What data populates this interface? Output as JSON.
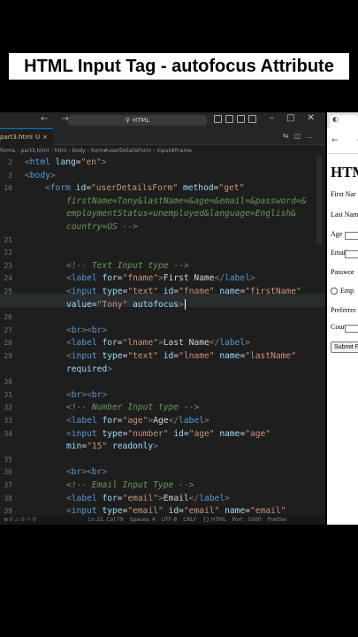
{
  "banner": {
    "title": "HTML Input Tag - autofocus Attribute"
  },
  "editor": {
    "search_label": "HTML",
    "tab_name": "part3.html",
    "tab_badge": "U",
    "left_tab_fragment": "forms",
    "breadcrumb": [
      "forms",
      "part3.html",
      "html",
      "body",
      "form#userDetailsForm",
      "input#fname"
    ],
    "lines": [
      {
        "n": "2",
        "indent": 1,
        "html": [
          [
            "tg",
            "<"
          ],
          [
            "tn",
            "html"
          ],
          [
            "an",
            " lang"
          ],
          [
            "tx",
            "="
          ],
          [
            "av",
            "\"en\""
          ],
          [
            "tg",
            ">"
          ]
        ]
      },
      {
        "n": "3",
        "indent": 1,
        "html": [
          [
            "tg",
            "<"
          ],
          [
            "tn",
            "body"
          ],
          [
            "tg",
            ">"
          ]
        ]
      },
      {
        "n": "10",
        "indent": 2,
        "html": [
          [
            "tg",
            "<"
          ],
          [
            "tn",
            "form"
          ],
          [
            "an",
            " id"
          ],
          [
            "tx",
            "="
          ],
          [
            "av",
            "\"userDetailsForm\""
          ],
          [
            "an",
            " method"
          ],
          [
            "tx",
            "="
          ],
          [
            "av",
            "\"get\""
          ]
        ]
      },
      {
        "n": "",
        "indent": 3,
        "html": [
          [
            "cm",
            "firstName=Tony&lastName=&age=&email=&password=&"
          ]
        ]
      },
      {
        "n": "",
        "indent": 3,
        "html": [
          [
            "cm",
            "employmentStatus=unemployed&language=English&"
          ]
        ]
      },
      {
        "n": "",
        "indent": 3,
        "html": [
          [
            "cm",
            "country=US -->"
          ]
        ]
      },
      {
        "n": "21",
        "indent": 3,
        "html": []
      },
      {
        "n": "22",
        "indent": 3,
        "html": []
      },
      {
        "n": "23",
        "indent": 3,
        "html": [
          [
            "cm",
            "<!-- Text Input type -->"
          ]
        ]
      },
      {
        "n": "24",
        "indent": 3,
        "html": [
          [
            "tg",
            "<"
          ],
          [
            "tn",
            "label"
          ],
          [
            "an",
            " for"
          ],
          [
            "tx",
            "="
          ],
          [
            "av",
            "\"fname\""
          ],
          [
            "tg",
            ">"
          ],
          [
            "tx",
            "First Name"
          ],
          [
            "tg",
            "</"
          ],
          [
            "tn",
            "label"
          ],
          [
            "tg",
            ">"
          ]
        ]
      },
      {
        "n": "25",
        "indent": 3,
        "html": [
          [
            "tg",
            "<"
          ],
          [
            "tn",
            "input"
          ],
          [
            "an",
            " type"
          ],
          [
            "tx",
            "="
          ],
          [
            "av",
            "\"text\""
          ],
          [
            "an",
            " id"
          ],
          [
            "tx",
            "="
          ],
          [
            "av",
            "\"fname\""
          ],
          [
            "an",
            " name"
          ],
          [
            "tx",
            "="
          ],
          [
            "av",
            "\"firstName\""
          ]
        ]
      },
      {
        "n": "",
        "indent": 3,
        "html": [
          [
            "an",
            "value"
          ],
          [
            "tx",
            "="
          ],
          [
            "av",
            "\"Tony\""
          ],
          [
            "an",
            " autofocus"
          ],
          [
            "tg",
            ">"
          ]
        ],
        "cursor": true
      },
      {
        "n": "26",
        "indent": 3,
        "html": []
      },
      {
        "n": "27",
        "indent": 3,
        "html": [
          [
            "tg",
            "<"
          ],
          [
            "tn",
            "br"
          ],
          [
            "tg",
            "><"
          ],
          [
            "tn",
            "br"
          ],
          [
            "tg",
            ">"
          ]
        ]
      },
      {
        "n": "28",
        "indent": 3,
        "html": [
          [
            "tg",
            "<"
          ],
          [
            "tn",
            "label"
          ],
          [
            "an",
            " for"
          ],
          [
            "tx",
            "="
          ],
          [
            "av",
            "\"lname\""
          ],
          [
            "tg",
            ">"
          ],
          [
            "tx",
            "Last Name"
          ],
          [
            "tg",
            "</"
          ],
          [
            "tn",
            "label"
          ],
          [
            "tg",
            ">"
          ]
        ]
      },
      {
        "n": "29",
        "indent": 3,
        "html": [
          [
            "tg",
            "<"
          ],
          [
            "tn",
            "input"
          ],
          [
            "an",
            " type"
          ],
          [
            "tx",
            "="
          ],
          [
            "av",
            "\"text\""
          ],
          [
            "an",
            " id"
          ],
          [
            "tx",
            "="
          ],
          [
            "av",
            "\"lname\""
          ],
          [
            "an",
            " name"
          ],
          [
            "tx",
            "="
          ],
          [
            "av",
            "\"lastName\""
          ]
        ]
      },
      {
        "n": "",
        "indent": 3,
        "html": [
          [
            "an",
            "required"
          ],
          [
            "tg",
            ">"
          ]
        ]
      },
      {
        "n": "30",
        "indent": 3,
        "html": []
      },
      {
        "n": "31",
        "indent": 3,
        "html": [
          [
            "tg",
            "<"
          ],
          [
            "tn",
            "br"
          ],
          [
            "tg",
            "><"
          ],
          [
            "tn",
            "br"
          ],
          [
            "tg",
            ">"
          ]
        ]
      },
      {
        "n": "32",
        "indent": 3,
        "html": [
          [
            "cm",
            "<!-- Number Input type -->"
          ]
        ]
      },
      {
        "n": "33",
        "indent": 3,
        "html": [
          [
            "tg",
            "<"
          ],
          [
            "tn",
            "label"
          ],
          [
            "an",
            " for"
          ],
          [
            "tx",
            "="
          ],
          [
            "av",
            "\"age\""
          ],
          [
            "tg",
            ">"
          ],
          [
            "tx",
            "Age"
          ],
          [
            "tg",
            "</"
          ],
          [
            "tn",
            "label"
          ],
          [
            "tg",
            ">"
          ]
        ]
      },
      {
        "n": "34",
        "indent": 3,
        "html": [
          [
            "tg",
            "<"
          ],
          [
            "tn",
            "input"
          ],
          [
            "an",
            " type"
          ],
          [
            "tx",
            "="
          ],
          [
            "av",
            "\"number\""
          ],
          [
            "an",
            " id"
          ],
          [
            "tx",
            "="
          ],
          [
            "av",
            "\"age\""
          ],
          [
            "an",
            " name"
          ],
          [
            "tx",
            "="
          ],
          [
            "av",
            "\"age\""
          ]
        ]
      },
      {
        "n": "",
        "indent": 3,
        "html": [
          [
            "an",
            "min"
          ],
          [
            "tx",
            "="
          ],
          [
            "av",
            "\"15\""
          ],
          [
            "an",
            " readonly"
          ],
          [
            "tg",
            ">"
          ]
        ]
      },
      {
        "n": "35",
        "indent": 3,
        "html": []
      },
      {
        "n": "36",
        "indent": 3,
        "html": [
          [
            "tg",
            "<"
          ],
          [
            "tn",
            "br"
          ],
          [
            "tg",
            "><"
          ],
          [
            "tn",
            "br"
          ],
          [
            "tg",
            ">"
          ]
        ]
      },
      {
        "n": "37",
        "indent": 3,
        "html": [
          [
            "cm",
            "<!-- Email Input Type -->"
          ]
        ]
      },
      {
        "n": "38",
        "indent": 3,
        "html": [
          [
            "tg",
            "<"
          ],
          [
            "tn",
            "label"
          ],
          [
            "an",
            " for"
          ],
          [
            "tx",
            "="
          ],
          [
            "av",
            "\"email\""
          ],
          [
            "tg",
            ">"
          ],
          [
            "tx",
            "Email"
          ],
          [
            "tg",
            "</"
          ],
          [
            "tn",
            "label"
          ],
          [
            "tg",
            ">"
          ]
        ]
      },
      {
        "n": "39",
        "indent": 3,
        "html": [
          [
            "tg",
            "<"
          ],
          [
            "tn",
            "input"
          ],
          [
            "an",
            " type"
          ],
          [
            "tx",
            "="
          ],
          [
            "av",
            "\"email\""
          ],
          [
            "an",
            " id"
          ],
          [
            "tx",
            "="
          ],
          [
            "av",
            "\"email\""
          ],
          [
            "an",
            " name"
          ],
          [
            "tx",
            "="
          ],
          [
            "av",
            "\"email\""
          ]
        ]
      }
    ],
    "status_left": "⊗ 0 ⚠ 0  ⚐ 0",
    "status_items": [
      "Ln 25, Col 79",
      "Spaces: 4",
      "UTF-8",
      "CRLF",
      "{} HTML",
      "Port : 5500",
      "Prettier"
    ]
  },
  "browser": {
    "tab_icon": "◐",
    "nav": "← →",
    "heading": "HTM",
    "labels": [
      {
        "text": "First Nar",
        "input": false
      },
      {
        "text": "Last Nam",
        "input": false
      },
      {
        "text": "Age",
        "input": true
      },
      {
        "text": "Email",
        "input": true
      },
      {
        "text": "Passwor",
        "input": false
      },
      {
        "text": "Emp",
        "radio": true
      },
      {
        "text": "Preferrec",
        "input": false
      },
      {
        "text": "Country",
        "input": true
      }
    ],
    "submit_label": "Submit F"
  },
  "colors": {
    "accent": "#0078d4",
    "editor_bg": "#1e1e1e",
    "tag_name": "#569cd6",
    "attr_name": "#9cdcfe",
    "attr_value": "#ce9178",
    "comment": "#6a9955"
  }
}
